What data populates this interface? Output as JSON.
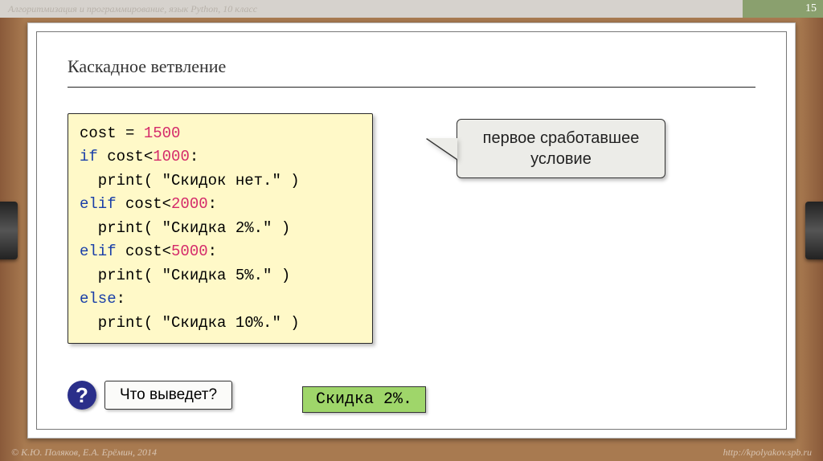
{
  "header": {
    "breadcrumb": "Алгоритмизация и программирование, язык Python, 10 класс",
    "page_number": "15"
  },
  "title": "Каскадное ветвление",
  "code": {
    "l1_a": "cost = ",
    "l1_n": "1500",
    "l2_a": "if",
    "l2_b": " cost<",
    "l2_n": "1000",
    "l2_c": ":",
    "l3": "  print( \"Скидок нет.\" )",
    "l4_a": "elif",
    "l4_b": " cost<",
    "l4_n": "2000",
    "l4_c": ":",
    "l5": "  print( \"Скидка 2%.\" )",
    "l6_a": "elif",
    "l6_b": " cost<",
    "l6_n": "5000",
    "l6_c": ":",
    "l7": "  print( \"Скидка 5%.\" )",
    "l8_a": "else",
    "l8_b": ":",
    "l9": "  print( \"Скидка 10%.\" )"
  },
  "callout": {
    "line1": "первое сработавшее",
    "line2": "условие"
  },
  "question": {
    "mark": "?",
    "text": "Что выведет?"
  },
  "answer": "Скидка 2%.",
  "footer": {
    "left": "© К.Ю. Поляков, Е.А. Ерёмин, 2014",
    "right": "http://kpolyakov.spb.ru"
  }
}
